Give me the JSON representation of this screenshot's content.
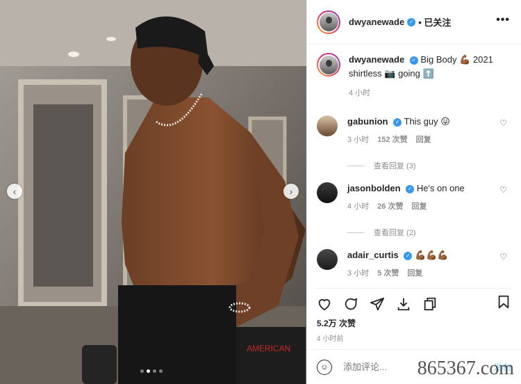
{
  "post": {
    "author": "dwyanewade",
    "follow_label": "• 已关注",
    "more_label": "•••"
  },
  "caption": {
    "author": "dwyanewade",
    "text": "Big Body 💪🏾 2021 shirtless 📷 going ⬆️",
    "time": "4 小时"
  },
  "comments": [
    {
      "user": "gabunion",
      "text": "This guy 😛",
      "time": "3 小时",
      "likes": "152 次赞",
      "reply_label": "回复",
      "view_replies": "查看回复 (3)"
    },
    {
      "user": "jasonbolden",
      "text": "He's on one",
      "time": "4 小时",
      "likes": "26 次赞",
      "reply_label": "回复",
      "view_replies": "查看回复 (2)"
    },
    {
      "user": "adair_curtis",
      "text": "💪🏾💪🏾💪🏾",
      "time": "3 小时",
      "likes": "5 次赞",
      "reply_label": "回复"
    }
  ],
  "stats": {
    "likes": "5.2万 次赞",
    "time": "4 小时前"
  },
  "comment_box": {
    "placeholder": "添加评论...",
    "post_label": "发布"
  },
  "watermark": "865367.com",
  "icons": [
    "heart-icon",
    "comment-icon",
    "share-icon",
    "download-icon",
    "copy-icon",
    "bookmark-icon",
    "emoji-icon",
    "chevron-left-icon",
    "chevron-right-icon"
  ],
  "colors": {
    "verified": "#3897f0",
    "meta_text": "#8e8e8e",
    "post_button": "#b2dffc"
  },
  "carousel": {
    "total_slides": 4,
    "active_slide": 2
  }
}
